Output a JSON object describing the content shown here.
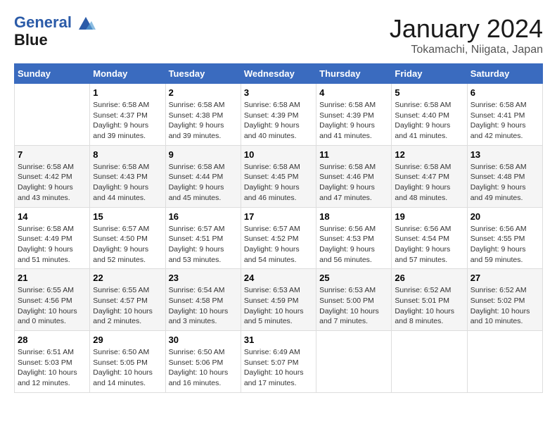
{
  "header": {
    "logo_line1": "General",
    "logo_line2": "Blue",
    "title": "January 2024",
    "subtitle": "Tokamachi, Niigata, Japan"
  },
  "calendar": {
    "days_of_week": [
      "Sunday",
      "Monday",
      "Tuesday",
      "Wednesday",
      "Thursday",
      "Friday",
      "Saturday"
    ],
    "weeks": [
      [
        {
          "date": "",
          "info": ""
        },
        {
          "date": "1",
          "info": "Sunrise: 6:58 AM\nSunset: 4:37 PM\nDaylight: 9 hours\nand 39 minutes."
        },
        {
          "date": "2",
          "info": "Sunrise: 6:58 AM\nSunset: 4:38 PM\nDaylight: 9 hours\nand 39 minutes."
        },
        {
          "date": "3",
          "info": "Sunrise: 6:58 AM\nSunset: 4:39 PM\nDaylight: 9 hours\nand 40 minutes."
        },
        {
          "date": "4",
          "info": "Sunrise: 6:58 AM\nSunset: 4:39 PM\nDaylight: 9 hours\nand 41 minutes."
        },
        {
          "date": "5",
          "info": "Sunrise: 6:58 AM\nSunset: 4:40 PM\nDaylight: 9 hours\nand 41 minutes."
        },
        {
          "date": "6",
          "info": "Sunrise: 6:58 AM\nSunset: 4:41 PM\nDaylight: 9 hours\nand 42 minutes."
        }
      ],
      [
        {
          "date": "7",
          "info": "Sunrise: 6:58 AM\nSunset: 4:42 PM\nDaylight: 9 hours\nand 43 minutes."
        },
        {
          "date": "8",
          "info": "Sunrise: 6:58 AM\nSunset: 4:43 PM\nDaylight: 9 hours\nand 44 minutes."
        },
        {
          "date": "9",
          "info": "Sunrise: 6:58 AM\nSunset: 4:44 PM\nDaylight: 9 hours\nand 45 minutes."
        },
        {
          "date": "10",
          "info": "Sunrise: 6:58 AM\nSunset: 4:45 PM\nDaylight: 9 hours\nand 46 minutes."
        },
        {
          "date": "11",
          "info": "Sunrise: 6:58 AM\nSunset: 4:46 PM\nDaylight: 9 hours\nand 47 minutes."
        },
        {
          "date": "12",
          "info": "Sunrise: 6:58 AM\nSunset: 4:47 PM\nDaylight: 9 hours\nand 48 minutes."
        },
        {
          "date": "13",
          "info": "Sunrise: 6:58 AM\nSunset: 4:48 PM\nDaylight: 9 hours\nand 49 minutes."
        }
      ],
      [
        {
          "date": "14",
          "info": "Sunrise: 6:58 AM\nSunset: 4:49 PM\nDaylight: 9 hours\nand 51 minutes."
        },
        {
          "date": "15",
          "info": "Sunrise: 6:57 AM\nSunset: 4:50 PM\nDaylight: 9 hours\nand 52 minutes."
        },
        {
          "date": "16",
          "info": "Sunrise: 6:57 AM\nSunset: 4:51 PM\nDaylight: 9 hours\nand 53 minutes."
        },
        {
          "date": "17",
          "info": "Sunrise: 6:57 AM\nSunset: 4:52 PM\nDaylight: 9 hours\nand 54 minutes."
        },
        {
          "date": "18",
          "info": "Sunrise: 6:56 AM\nSunset: 4:53 PM\nDaylight: 9 hours\nand 56 minutes."
        },
        {
          "date": "19",
          "info": "Sunrise: 6:56 AM\nSunset: 4:54 PM\nDaylight: 9 hours\nand 57 minutes."
        },
        {
          "date": "20",
          "info": "Sunrise: 6:56 AM\nSunset: 4:55 PM\nDaylight: 9 hours\nand 59 minutes."
        }
      ],
      [
        {
          "date": "21",
          "info": "Sunrise: 6:55 AM\nSunset: 4:56 PM\nDaylight: 10 hours\nand 0 minutes."
        },
        {
          "date": "22",
          "info": "Sunrise: 6:55 AM\nSunset: 4:57 PM\nDaylight: 10 hours\nand 2 minutes."
        },
        {
          "date": "23",
          "info": "Sunrise: 6:54 AM\nSunset: 4:58 PM\nDaylight: 10 hours\nand 3 minutes."
        },
        {
          "date": "24",
          "info": "Sunrise: 6:53 AM\nSunset: 4:59 PM\nDaylight: 10 hours\nand 5 minutes."
        },
        {
          "date": "25",
          "info": "Sunrise: 6:53 AM\nSunset: 5:00 PM\nDaylight: 10 hours\nand 7 minutes."
        },
        {
          "date": "26",
          "info": "Sunrise: 6:52 AM\nSunset: 5:01 PM\nDaylight: 10 hours\nand 8 minutes."
        },
        {
          "date": "27",
          "info": "Sunrise: 6:52 AM\nSunset: 5:02 PM\nDaylight: 10 hours\nand 10 minutes."
        }
      ],
      [
        {
          "date": "28",
          "info": "Sunrise: 6:51 AM\nSunset: 5:03 PM\nDaylight: 10 hours\nand 12 minutes."
        },
        {
          "date": "29",
          "info": "Sunrise: 6:50 AM\nSunset: 5:05 PM\nDaylight: 10 hours\nand 14 minutes."
        },
        {
          "date": "30",
          "info": "Sunrise: 6:50 AM\nSunset: 5:06 PM\nDaylight: 10 hours\nand 16 minutes."
        },
        {
          "date": "31",
          "info": "Sunrise: 6:49 AM\nSunset: 5:07 PM\nDaylight: 10 hours\nand 17 minutes."
        },
        {
          "date": "",
          "info": ""
        },
        {
          "date": "",
          "info": ""
        },
        {
          "date": "",
          "info": ""
        }
      ]
    ]
  }
}
